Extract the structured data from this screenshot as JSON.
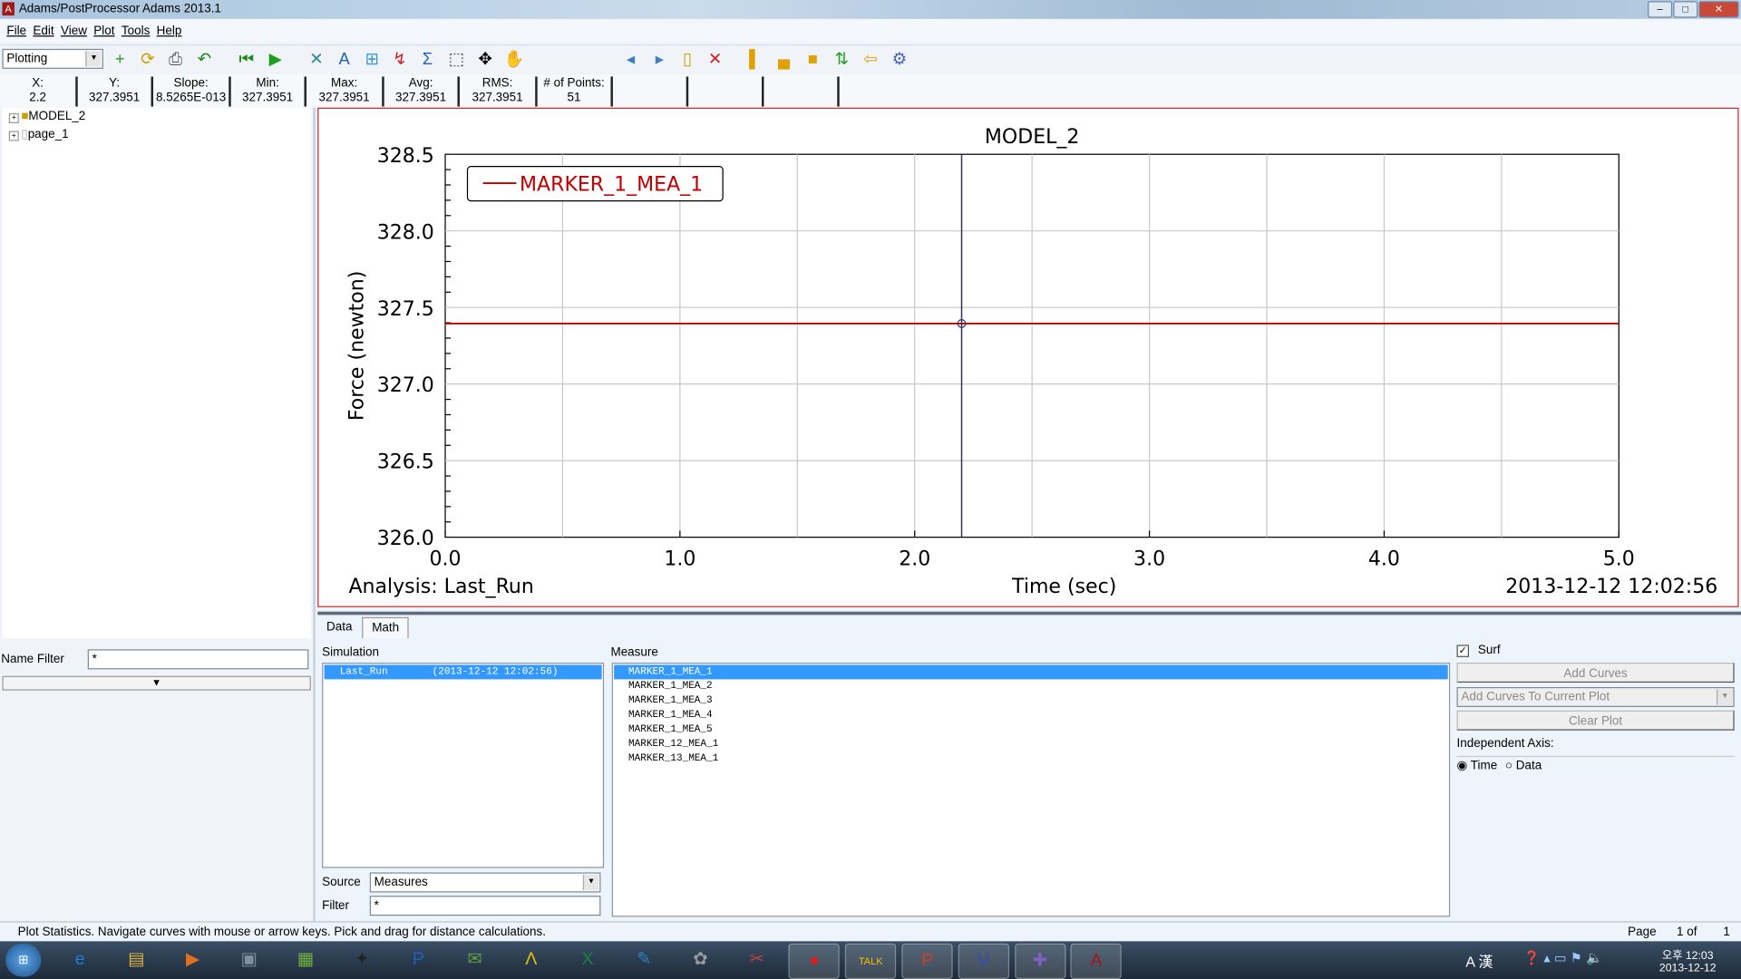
{
  "window": {
    "title": "Adams/PostProcessor Adams 2013.1"
  },
  "menu": [
    "File",
    "Edit",
    "View",
    "Plot",
    "Tools",
    "Help"
  ],
  "toolbar": {
    "mode": "Plotting",
    "icons": [
      "new-page-icon",
      "refresh-icon",
      "print-icon",
      "undo-icon",
      "rewind-icon",
      "play-icon",
      "tools-icon",
      "text-icon",
      "grid-icon",
      "curve-edit-icon",
      "sigma-icon",
      "zoom-box-icon",
      "fit-icon",
      "pan-hand-icon",
      "prev-page-icon",
      "next-page-icon",
      "new-blank-page-icon",
      "delete-page-icon",
      "layout-left-icon",
      "layout-bottom-icon",
      "layout-full-icon",
      "swap-icon",
      "import-icon",
      "settings-gear-icon"
    ]
  },
  "stats": [
    {
      "label": "X:",
      "value": "2.2"
    },
    {
      "label": "Y:",
      "value": "327.3951"
    },
    {
      "label": "Slope:",
      "value": "8.5265E-013"
    },
    {
      "label": "Min:",
      "value": "327.3951"
    },
    {
      "label": "Max:",
      "value": "327.3951"
    },
    {
      "label": "Avg:",
      "value": "327.3951"
    },
    {
      "label": "RMS:",
      "value": "327.3951"
    },
    {
      "label": "# of Points:",
      "value": "51"
    }
  ],
  "tree": [
    {
      "label": "MODEL_2"
    },
    {
      "label": "page_1"
    }
  ],
  "name_filter": {
    "label": "Name Filter",
    "value": "*"
  },
  "chart_data": {
    "type": "line",
    "title": "MODEL_2",
    "xlabel": "Time (sec)",
    "ylabel": "Force (newton)",
    "xlim": [
      0,
      5
    ],
    "ylim": [
      326.0,
      328.5
    ],
    "xticks": [
      "0.0",
      "1.0",
      "2.0",
      "3.0",
      "4.0",
      "5.0"
    ],
    "yticks": [
      "326.0",
      "326.5",
      "327.0",
      "327.5",
      "328.0",
      "328.5"
    ],
    "grid": true,
    "legend": "top-left",
    "series": [
      {
        "name": "MARKER_1_MEA_1",
        "color": "#c00000",
        "x": [
          0,
          5
        ],
        "y": [
          327.3951,
          327.3951
        ]
      }
    ],
    "cursor": {
      "x": 2.2,
      "y": 327.3951
    },
    "footer_left": "Analysis:  Last_Run",
    "footer_right": "2013-12-12 12:02:56"
  },
  "tabs": [
    "Data",
    "Math"
  ],
  "simulation": {
    "label": "Simulation",
    "items": [
      {
        "name": "Last_Run",
        "time": "(2013-12-12 12:02:56)"
      }
    ],
    "source_label": "Source",
    "source_value": "Measures",
    "filter_label": "Filter",
    "filter_value": "*"
  },
  "measure": {
    "label": "Measure",
    "items": [
      "MARKER_1_MEA_1",
      "MARKER_1_MEA_2",
      "MARKER_1_MEA_3",
      "MARKER_1_MEA_4",
      "MARKER_1_MEA_5",
      "MARKER_12_MEA_1",
      "MARKER_13_MEA_1"
    ]
  },
  "right": {
    "surf_label": "Surf",
    "surf_checked": true,
    "add_curves": "Add Curves",
    "add_mode": "Add Curves To Current Plot",
    "clear_plot": "Clear Plot",
    "indep_label": "Independent Axis:",
    "time": "Time",
    "data": "Data"
  },
  "status": {
    "text": "Plot Statistics.  Navigate curves with mouse or arrow keys.  Pick and drag for distance calculations.",
    "page_label": "Page",
    "page_of": "1 of",
    "page_total": "1"
  },
  "taskbar": {
    "clock_time": "오후 12:03",
    "clock_date": "2013-12-12",
    "tray": "A 漢"
  },
  "colors": {
    "accent": "#3399ff",
    "plot_border": "#c8282e",
    "curve": "#c00000"
  }
}
